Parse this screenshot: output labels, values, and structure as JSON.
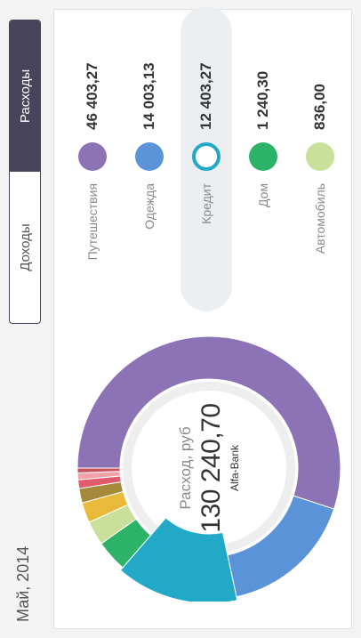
{
  "period": "Май, 2014",
  "tabs": {
    "expenses": "Расходы",
    "income": "Доходы",
    "active": "expenses"
  },
  "summary": {
    "label": "Расход, руб",
    "total": "130 240,70",
    "bank": "Alfa-Bank"
  },
  "categories": [
    {
      "name": "Путешествия",
      "value": "46 403,27",
      "color": "#8b73b5",
      "selected": false
    },
    {
      "name": "Одежда",
      "value": "14 003,13",
      "color": "#5b93d9",
      "selected": false
    },
    {
      "name": "Кредит",
      "value": "12 403,27",
      "color": "#22a9c7",
      "selected": true
    },
    {
      "name": "Дом",
      "value": "1 240,30",
      "color": "#2cb368",
      "selected": false
    },
    {
      "name": "Автомобиль",
      "value": "836,00",
      "color": "#c8e09a",
      "selected": false
    }
  ],
  "chart_data": {
    "type": "pie",
    "values": [
      46403.27,
      14003.13,
      12403.27,
      3300,
      2500,
      2100,
      1500,
      900,
      700,
      500
    ],
    "colors": [
      "#8b73b5",
      "#5b93d9",
      "#22a9c7",
      "#2cb368",
      "#c8e09a",
      "#e9b93a",
      "#a58a3b",
      "#e05c6c",
      "#f0a2a8",
      "#c9525d"
    ]
  }
}
